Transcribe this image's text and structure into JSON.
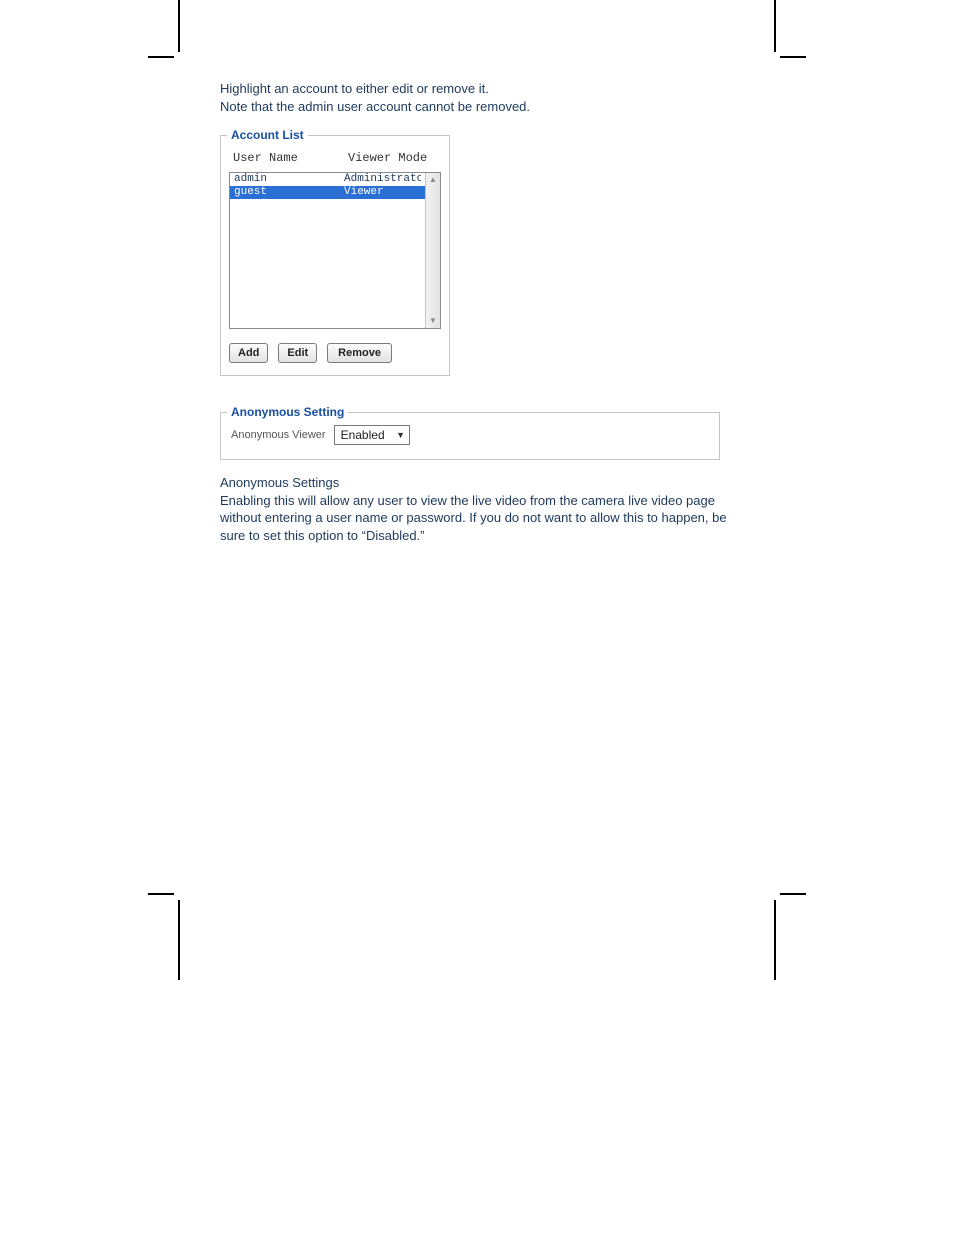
{
  "intro": {
    "line1": "Highlight an account to either edit or remove it.",
    "line2": "Note that the admin user account cannot be removed."
  },
  "account_list": {
    "legend": "Account List",
    "headers": {
      "col1": "User Name",
      "col2": "Viewer Mode"
    },
    "rows": [
      {
        "user": "admin",
        "mode": "Administrato",
        "selected": false
      },
      {
        "user": "guest",
        "mode": "Viewer",
        "selected": true
      }
    ],
    "buttons": {
      "add": "Add",
      "edit": "Edit",
      "remove": "Remove"
    },
    "scroll": {
      "up": "▲",
      "down": "▼"
    }
  },
  "anonymous_setting": {
    "legend": "Anonymous Setting",
    "label": "Anonymous Viewer",
    "value": "Enabled",
    "arrow": "▼"
  },
  "anonymous_desc": {
    "title": "Anonymous Settings",
    "body": "Enabling this will allow any user to view the live video from the camera live video page without entering a user name or password. If you do not want to allow this to happen, be sure to set this option to “Disabled.”"
  }
}
